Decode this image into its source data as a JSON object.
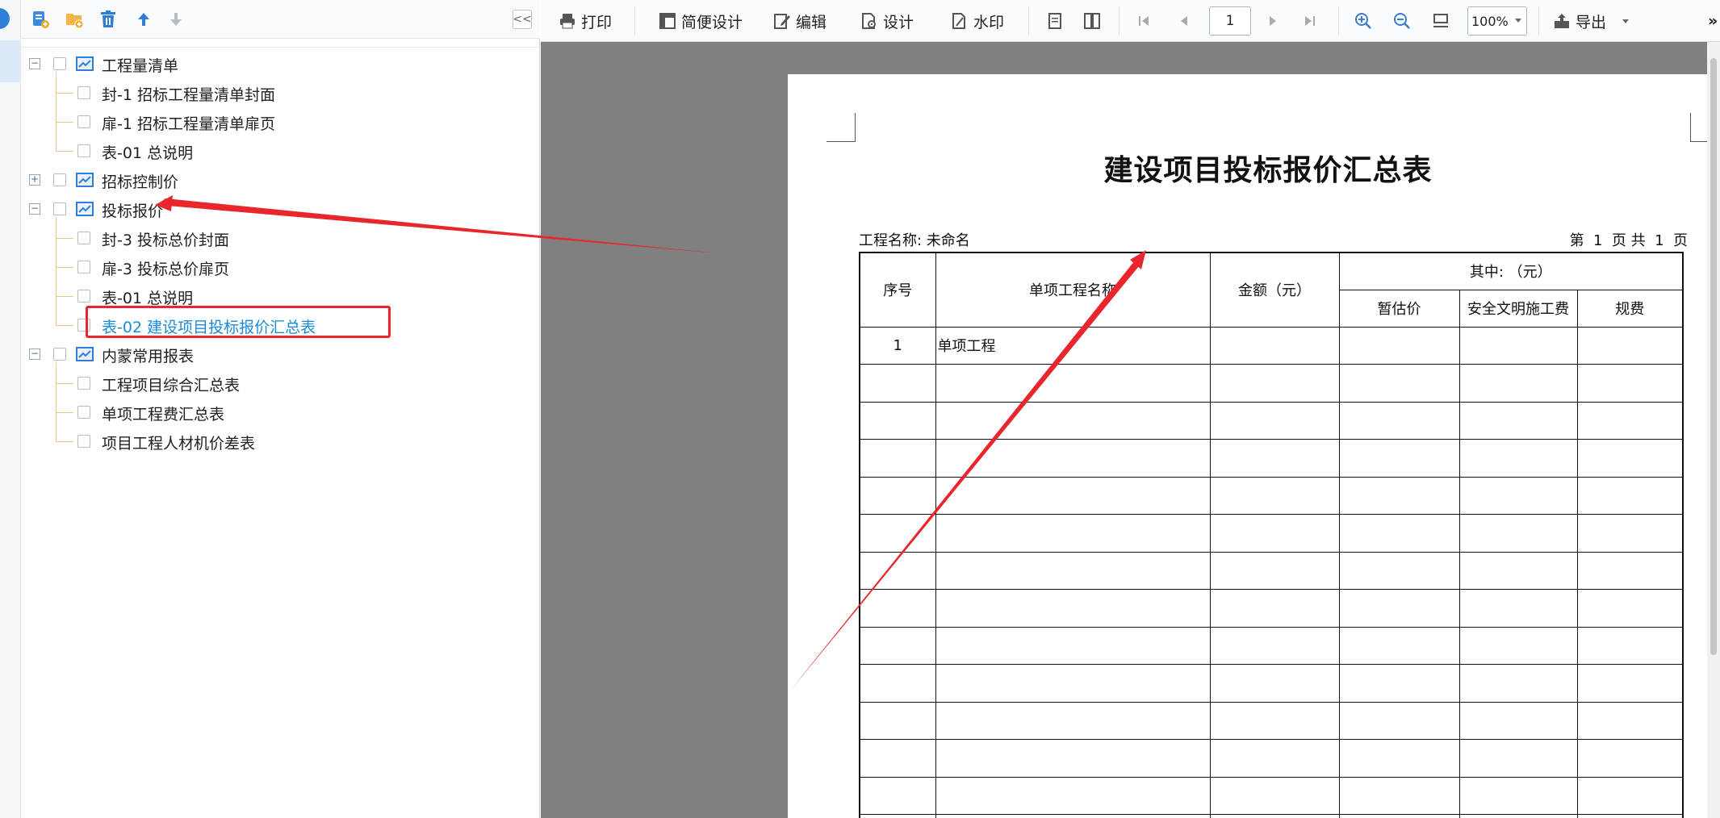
{
  "left_panel": {
    "toolbar_icons": [
      "add-report-icon",
      "add-folder-icon",
      "delete-icon",
      "move-up-icon",
      "move-down-icon"
    ],
    "collapse_label": "<<",
    "tree": [
      {
        "label": "工程量清单",
        "level": 0,
        "toggle": "⊟"
      },
      {
        "label": "封-1 招标工程量清单封面",
        "level": 1
      },
      {
        "label": "扉-1 招标工程量清单扉页",
        "level": 1
      },
      {
        "label": "表-01 总说明",
        "level": 1
      },
      {
        "label": "招标控制价",
        "level": 0,
        "toggle": "⊞"
      },
      {
        "label": "投标报价",
        "level": 0,
        "toggle": "⊟"
      },
      {
        "label": "封-3 投标总价封面",
        "level": 1
      },
      {
        "label": "扉-3 投标总价扉页",
        "level": 1
      },
      {
        "label": "表-01 总说明",
        "level": 1
      },
      {
        "label": "表-02 建设项目投标报价汇总表",
        "level": 1,
        "active": true
      },
      {
        "label": "内蒙常用报表",
        "level": 0,
        "toggle": "⊟"
      },
      {
        "label": "工程项目综合汇总表",
        "level": 1
      },
      {
        "label": "单项工程费汇总表",
        "level": 1
      },
      {
        "label": "项目工程人材机价差表",
        "level": 1
      }
    ]
  },
  "toolbar": {
    "print": "打印",
    "simple_design": "简便设计",
    "edit": "编辑",
    "design": "设计",
    "watermark": "水印",
    "page_value": "1",
    "zoom_value": "100%",
    "export": "导出",
    "more": "»"
  },
  "document": {
    "title": "建设项目投标报价汇总表",
    "project_line": "工程名称: 未命名",
    "page_line": "第  1  页 共  1  页",
    "headers": {
      "seq": "序号",
      "name": "单项工程名称",
      "amount": "金额（元）",
      "of_which": "其中: （元）",
      "provisional": "暂估价",
      "safety": "安全文明施工费",
      "fees": "规费"
    },
    "rows": [
      {
        "seq": "1",
        "name": "单项工程",
        "amount": "",
        "provisional": "",
        "safety": "",
        "fees": ""
      }
    ],
    "blank_rows": 13
  },
  "colors": {
    "annotation_red": "#e8262b",
    "active_item_blue": "#1a8cd8",
    "icon_blue": "#2f7fd8",
    "tree_line_orange": "#f0c48a"
  }
}
